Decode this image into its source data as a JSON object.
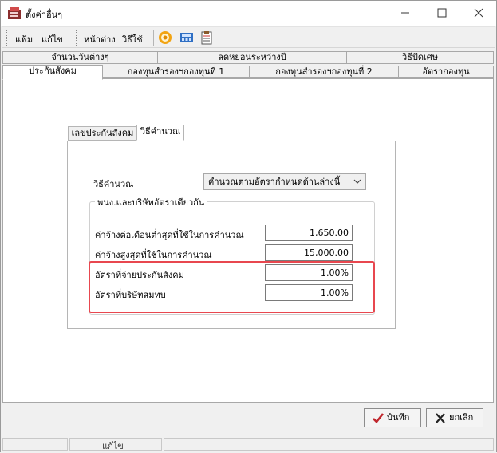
{
  "window": {
    "title": "ตั้งค่าอื่นๆ"
  },
  "menu": {
    "file": "แฟ้ม",
    "edit": "แก้ไข",
    "window": "หน้าต่าง",
    "help": "วิธีใช้"
  },
  "toolbar_icons": [
    "gear-icon",
    "calculator-icon",
    "clipboard-icon"
  ],
  "tabs_row1": [
    "จำนวนวันต่างๆ",
    "ลดหย่อนระหว่างปี",
    "วิธีปัดเศษ"
  ],
  "tabs_row2": [
    "ประกันสังคม",
    "กองทุนสำรองฯกองทุนที่ 1",
    "กองทุนสำรองฯกองทุนที่ 2",
    "อัตรากองทุน"
  ],
  "active_tab": "ประกันสังคม",
  "inner_tabs": [
    "เลขประกันสังคม",
    "วิธีคำนวณ"
  ],
  "active_inner_tab": "วิธีคำนวณ",
  "form": {
    "method_label": "วิธีคำนวณ",
    "method_value": "คำนวณตามอัตรากำหนดด้านล่างนี้",
    "group_title": "พนง.และบริษัทอัตราเดียวกัน",
    "rows": [
      {
        "label": "ค่าจ้างต่อเดือนต่ำสุดที่ใช้ในการคำนวณ",
        "value": "1,650.00"
      },
      {
        "label": "ค่าจ้างสูงสุดที่ใช้ในการคำนวณ",
        "value": "15,000.00"
      },
      {
        "label": "อัตราที่จ่ายประกันสังคม",
        "value": "1.00%"
      },
      {
        "label": "อัตราที่บริษัทสมทบ",
        "value": "1.00%"
      }
    ]
  },
  "buttons": {
    "save": "บันทึก",
    "cancel": "ยกเลิก"
  },
  "status": {
    "text": "แก้ไข"
  },
  "colors": {
    "highlight": "#e8474f",
    "save_check": "#c0272d"
  }
}
